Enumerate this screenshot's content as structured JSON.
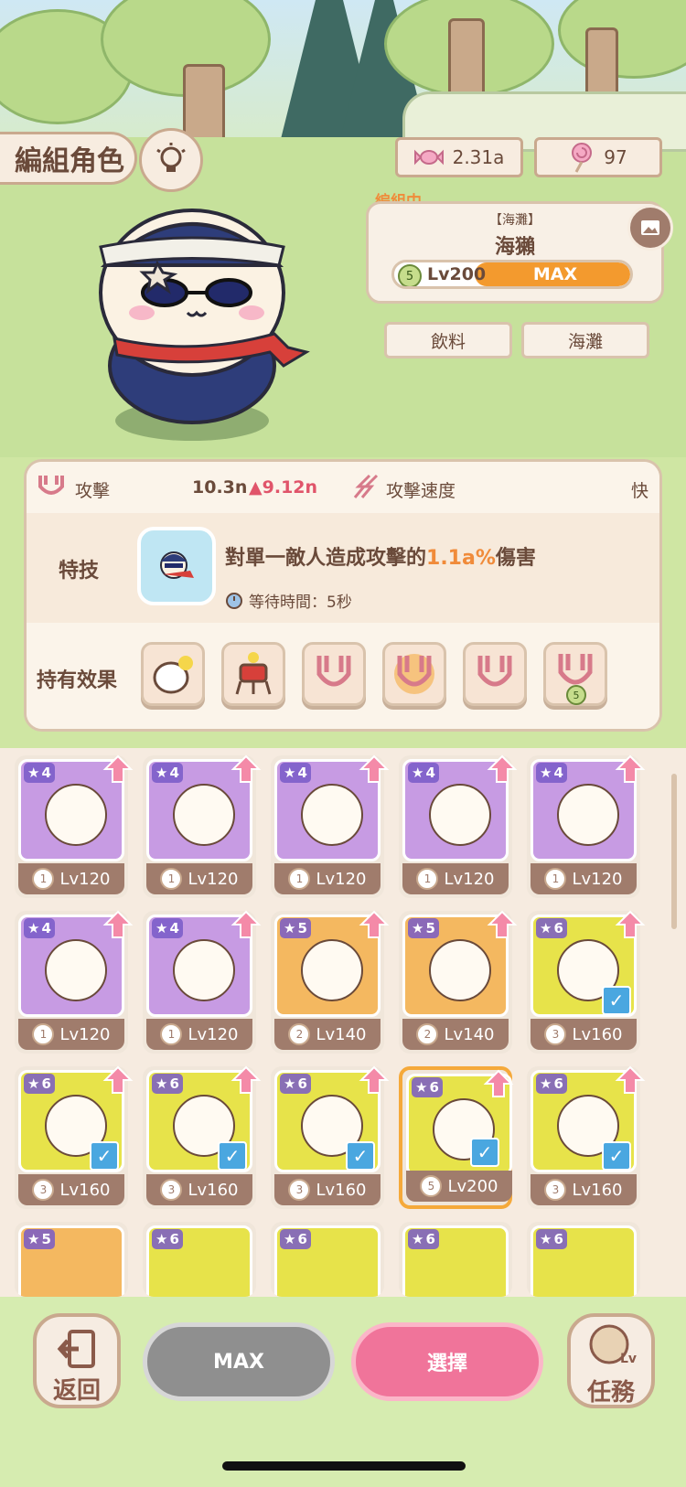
{
  "header": {
    "title": "編組角色"
  },
  "currency": {
    "candy": "2.31a",
    "lollipop": "97"
  },
  "team": {
    "label": "編組中",
    "location_tag": "【海灘】",
    "character_name": "海獺",
    "level_badge": "5",
    "level": "Lv200",
    "max_label": "MAX",
    "tag_left": "飲料",
    "tag_right": "海灘"
  },
  "stats": {
    "attack_label": "攻擊",
    "attack_value": "10.3n",
    "attack_bonus": "9.12n",
    "speed_label": "攻擊速度",
    "speed_value": "快",
    "skill_label": "特技",
    "skill_desc_prefix": "對單一敵人造成攻擊的",
    "skill_desc_value": "1.1a%",
    "skill_desc_suffix": "傷害",
    "wait_label": "等待時間：5秒",
    "effects_label": "持有效果",
    "effect_level_badge": "5"
  },
  "cards": [
    {
      "stars": "4",
      "badge": "1",
      "level": "Lv120",
      "color": "#c79be3",
      "checked": false
    },
    {
      "stars": "4",
      "badge": "1",
      "level": "Lv120",
      "color": "#c79be3",
      "checked": false
    },
    {
      "stars": "4",
      "badge": "1",
      "level": "Lv120",
      "color": "#c79be3",
      "checked": false
    },
    {
      "stars": "4",
      "badge": "1",
      "level": "Lv120",
      "color": "#c79be3",
      "checked": false
    },
    {
      "stars": "4",
      "badge": "1",
      "level": "Lv120",
      "color": "#c79be3",
      "checked": false
    },
    {
      "stars": "4",
      "badge": "1",
      "level": "Lv120",
      "color": "#c79be3",
      "checked": false
    },
    {
      "stars": "4",
      "badge": "1",
      "level": "Lv120",
      "color": "#c79be3",
      "checked": false
    },
    {
      "stars": "5",
      "badge": "2",
      "level": "Lv140",
      "color": "#f4b860",
      "checked": false
    },
    {
      "stars": "5",
      "badge": "2",
      "level": "Lv140",
      "color": "#f4b860",
      "checked": false
    },
    {
      "stars": "6",
      "badge": "3",
      "level": "Lv160",
      "color": "#e7e34a",
      "checked": true
    },
    {
      "stars": "6",
      "badge": "3",
      "level": "Lv160",
      "color": "#e7e34a",
      "checked": true
    },
    {
      "stars": "6",
      "badge": "3",
      "level": "Lv160",
      "color": "#e7e34a",
      "checked": true
    },
    {
      "stars": "6",
      "badge": "3",
      "level": "Lv160",
      "color": "#e7e34a",
      "checked": true
    },
    {
      "stars": "6",
      "badge": "5",
      "level": "Lv200",
      "color": "#e7e34a",
      "checked": true
    },
    {
      "stars": "6",
      "badge": "3",
      "level": "Lv160",
      "color": "#e7e34a",
      "checked": true
    }
  ],
  "partial_cards": [
    {
      "stars": "5",
      "color": "#f4b860"
    },
    {
      "stars": "6",
      "color": "#e7e34a"
    },
    {
      "stars": "6",
      "color": "#e7e34a"
    },
    {
      "stars": "6",
      "color": "#e7e34a"
    },
    {
      "stars": "6",
      "color": "#e7e34a"
    }
  ],
  "bottom": {
    "back_label": "返回",
    "max_label": "MAX",
    "select_label": "選擇",
    "mission_label": "任務",
    "mission_lv": "Lv"
  }
}
